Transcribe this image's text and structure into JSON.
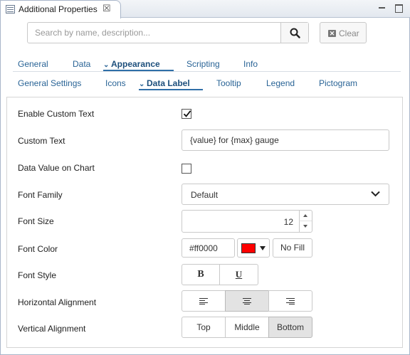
{
  "window": {
    "tab_title": "Additional Properties",
    "close_glyph": "☒"
  },
  "search": {
    "placeholder": "Search by name, description...",
    "value": "",
    "clear_label": "Clear"
  },
  "main_tabs": [
    {
      "label": "General",
      "active": false
    },
    {
      "label": "Data",
      "active": false
    },
    {
      "label": "Appearance",
      "active": true
    },
    {
      "label": "Scripting",
      "active": false
    },
    {
      "label": "Info",
      "active": false
    }
  ],
  "sub_tabs": [
    {
      "label": "General Settings",
      "active": false
    },
    {
      "label": "Icons",
      "active": false
    },
    {
      "label": "Data Label",
      "active": true
    },
    {
      "label": "Tooltip",
      "active": false
    },
    {
      "label": "Legend",
      "active": false
    },
    {
      "label": "Pictogram",
      "active": false
    }
  ],
  "form": {
    "enable_custom_text": {
      "label": "Enable Custom Text",
      "checked": true
    },
    "custom_text": {
      "label": "Custom Text",
      "value": "{value} for {max} gauge"
    },
    "data_value_on_chart": {
      "label": "Data Value on Chart",
      "checked": false
    },
    "font_family": {
      "label": "Font Family",
      "value": "Default"
    },
    "font_size": {
      "label": "Font Size",
      "value": "12"
    },
    "font_color": {
      "label": "Font Color",
      "hex": "#ff0000",
      "swatch": "#ff0000",
      "no_fill_label": "No Fill"
    },
    "font_style": {
      "label": "Font Style",
      "bold_glyph": "B",
      "underline_glyph": "U"
    },
    "horizontal_alignment": {
      "label": "Horizontal Alignment",
      "options": [
        "left",
        "center",
        "right"
      ],
      "selected": "center"
    },
    "vertical_alignment": {
      "label": "Vertical Alignment",
      "options": [
        "Top",
        "Middle",
        "Bottom"
      ],
      "selected": "Bottom"
    }
  },
  "colors": {
    "link_blue": "#2a6496",
    "active_tab": "#1d4f7c",
    "underline": "#2f6fa8",
    "border": "#c9c9c9"
  }
}
